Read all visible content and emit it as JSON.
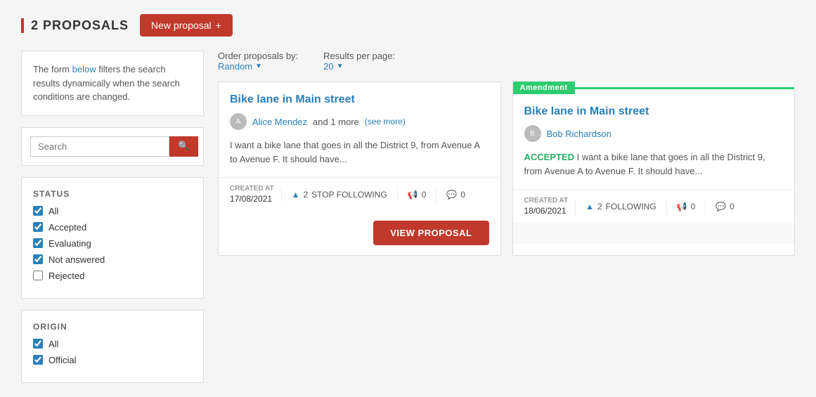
{
  "header": {
    "proposals_count": "2 PROPOSALS",
    "new_proposal_btn": "New proposal",
    "new_proposal_icon": "+"
  },
  "sidebar": {
    "info_text_1": "The form ",
    "info_link": "below",
    "info_text_2": " filters the search results dynamically when the search conditions are changed.",
    "search_placeholder": "Search",
    "search_icon": "🔍",
    "status_title": "STATUS",
    "status_filters": [
      {
        "label": "All",
        "checked": true,
        "id": "all"
      },
      {
        "label": "Accepted",
        "checked": true,
        "id": "accepted"
      },
      {
        "label": "Evaluating",
        "checked": true,
        "id": "evaluating"
      },
      {
        "label": "Not answered",
        "checked": true,
        "id": "not_answered"
      },
      {
        "label": "Rejected",
        "checked": false,
        "id": "rejected"
      }
    ],
    "origin_title": "ORIGIN",
    "origin_filters": [
      {
        "label": "All",
        "checked": true,
        "id": "origin_all"
      },
      {
        "label": "Official",
        "checked": true,
        "id": "origin_official"
      }
    ]
  },
  "sort_bar": {
    "order_label": "Order proposals by:",
    "order_value": "Random",
    "results_label": "Results per page:",
    "results_value": "20"
  },
  "proposals": [
    {
      "id": "proposal-1",
      "title": "Bike lane in Main street",
      "author_name": "Alice Mendez",
      "author_extra": "and 1 more",
      "see_more": "(see more)",
      "description": "I want a bike lane that goes in all the District 9, from Avenue A to Avenue F. It should have...",
      "created_at_label": "CREATED AT",
      "created_at": "17/08/2021",
      "follow_count": "2",
      "follow_label": "STOP FOLLOWING",
      "votes_count": "0",
      "comments_count": "0",
      "view_btn": "VIEW PROPOSAL",
      "amendment": false,
      "accepted": false
    },
    {
      "id": "proposal-2",
      "title": "Bike lane in Main street",
      "amendment_label": "Amendment",
      "author_name": "Bob Richardson",
      "description": "I want a bike lane that goes in all the District 9, from Avenue A to Avenue F. It should have...",
      "created_at_label": "CREATED AT",
      "created_at": "18/06/2021",
      "follow_count": "2",
      "follow_label": "FOLLOWING",
      "votes_count": "0",
      "comments_count": "0",
      "amendment": true,
      "accepted": true,
      "accepted_badge": "ACCEPTED"
    }
  ],
  "icons": {
    "search": "🔍",
    "follow": "▲",
    "votes": "📢",
    "comments": "💬"
  }
}
